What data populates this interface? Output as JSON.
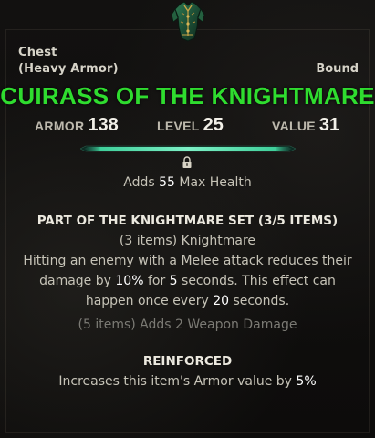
{
  "item": {
    "slot": "Chest",
    "armor_type": "(Heavy Armor)",
    "bound": "Bound",
    "name": "CUIRASS OF THE KNIGHTMARE",
    "icon": "chest-armor-icon"
  },
  "stats": {
    "armor_label": "ARMOR",
    "armor_value": "138",
    "level_label": "LEVEL",
    "level_value": "25",
    "value_label": "VALUE",
    "value_value": "31"
  },
  "enchant": {
    "lock_icon": "lock-icon",
    "pre": "Adds ",
    "amount": "55",
    "post": " Max Health"
  },
  "set": {
    "title": "PART OF THE KNIGHTMARE SET (3/5 ITEMS)",
    "bonus3_title": "(3 items) Knightmare",
    "bonus3_line1": "Hitting an enemy with a Melee attack reduces their",
    "bonus3_line2_pre": "damage by ",
    "bonus3_line2_pct": "10%",
    "bonus3_line2_mid": " for ",
    "bonus3_line2_secs": "5",
    "bonus3_line2_post": " seconds. This effect can",
    "bonus3_line3_pre": "happen once every ",
    "bonus3_line3_secs": "20",
    "bonus3_line3_post": " seconds.",
    "bonus5": "(5 items) Adds 2 Weapon Damage"
  },
  "trait": {
    "name": "REINFORCED",
    "desc_pre": "Increases this item's Armor value by ",
    "desc_pct": "5%"
  },
  "colors": {
    "name_green": "#2fdc2f",
    "bar_teal": "#3fcf9a",
    "text": "#c6c3b7",
    "dim": "#7b7a74"
  }
}
